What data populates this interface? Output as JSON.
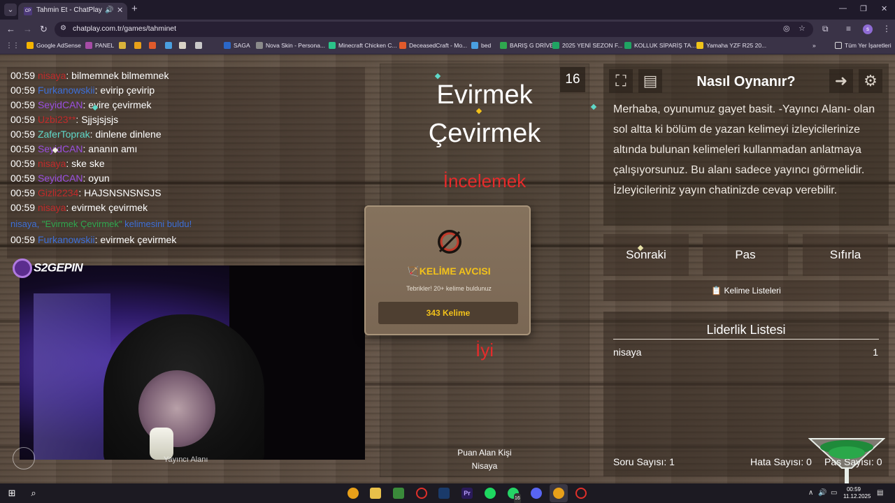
{
  "browser": {
    "tab_title": "Tahmin Et - ChatPlay",
    "tab_favicon": "CP",
    "url": "chatplay.com.tr/games/tahminet",
    "profile_initial": "s",
    "bookmarks": [
      {
        "label": "Google AdSense",
        "color": "#f4b400"
      },
      {
        "label": "PANEL",
        "color": "#a64ca6"
      },
      {
        "label": "",
        "color": "#d8b23a"
      },
      {
        "label": "",
        "color": "#e8a019"
      },
      {
        "label": "",
        "color": "#e05a2b"
      },
      {
        "label": "",
        "color": "#4a9fe0"
      },
      {
        "label": "",
        "color": "#d9d3c6"
      },
      {
        "label": "",
        "color": "#c9c9c9"
      },
      {
        "label": "SAGA",
        "color": "#2b67c8"
      },
      {
        "label": "Nova Skin - Persona...",
        "color": "#8a8a8a"
      },
      {
        "label": "Minecraft Chicken C...",
        "color": "#2bc48a"
      },
      {
        "label": "DeceasedCraft - Mo...",
        "color": "#e05a2b"
      },
      {
        "label": "bed",
        "color": "#4a9fe0"
      },
      {
        "label": "BARIŞ G DRİVE",
        "color": "#2fa84f"
      },
      {
        "label": "2025 YENİ SEZON F...",
        "color": "#1fa463"
      },
      {
        "label": "KOLLUK SİPARİŞ TA...",
        "color": "#1fa463"
      },
      {
        "label": "Yamaha YZF R25 20...",
        "color": "#f0c419"
      }
    ],
    "all_bookmarks": "Tüm Yer İşaretleri"
  },
  "chat": [
    {
      "time": "00:59",
      "user": "nisaya",
      "color": "#c02a2a",
      "msg": ": bilmemnek bilmemnek"
    },
    {
      "time": "00:59",
      "user": "Furkanowskii",
      "color": "#3d6fd8",
      "msg": ": evirip çevirip"
    },
    {
      "time": "00:59",
      "user": "SeyidCAN",
      "color": "#9a4fe0",
      "msg": ": evire çevirmek"
    },
    {
      "time": "00:59",
      "user": "Uzbi23**",
      "color": "#c02a2a",
      "msg": ": Sjjsjsjsjs"
    },
    {
      "time": "00:59",
      "user": "ZaferToprak",
      "color": "#5fd8c8",
      "msg": ": dinlene dinlene"
    },
    {
      "time": "00:59",
      "user": "SeyidCAN",
      "color": "#9a4fe0",
      "msg": ": ananın amı"
    },
    {
      "time": "00:59",
      "user": "nisaya",
      "color": "#c02a2a",
      "msg": ": ske ske"
    },
    {
      "time": "00:59",
      "user": "SeyidCAN",
      "color": "#9a4fe0",
      "msg": ": oyun"
    },
    {
      "time": "00:59",
      "user": "Gizli2234",
      "color": "#c02a2a",
      "msg": ": HAJSNSNSNSJS"
    },
    {
      "time": "00:59",
      "user": "nisaya",
      "color": "#c02a2a",
      "msg": ": evirmek çevirmek"
    }
  ],
  "system_msg": {
    "user": "nisaya,",
    "word": "\"Evirmek Çevirmek\"",
    "suffix": " kelimesini buldu!"
  },
  "last_chat": {
    "time": "00:59",
    "user": "Furkanowskii",
    "color": "#3d6fd8",
    "msg": ": evirmek çevirmek"
  },
  "stream": {
    "logo": "S2GEPIN",
    "label": "Yayıncı Alanı"
  },
  "game": {
    "word_count": "16",
    "word_line1": "Evirmek",
    "word_line2": "Çevirmek",
    "taboo1": "İncelemek",
    "taboo2": "İyi",
    "scorer_label": "Puan Alan Kişi",
    "scorer_name": "Nisaya"
  },
  "achievement": {
    "title": "KELİME AVCISI",
    "subtitle": "Tebrikler! 20+ kelime buldunuz",
    "button": "343 Kelime"
  },
  "info": {
    "title": "Nasıl Oynanır?",
    "text": "Merhaba, oyunumuz gayet basit. -Yayıncı Alanı- olan sol altta ki bölüm de yazan kelimeyi izleyicilerinize altında bulunan kelimeleri kullanmadan anlatmaya çalışıyorsunuz. Bu alanı sadece yayıncı görmelidir. İzleyicileriniz yayın chatinizde cevap verebilir."
  },
  "actions": {
    "next": "Sonraki",
    "pass": "Pas",
    "reset": "Sıfırla",
    "word_lists": "Kelime Listeleri"
  },
  "leaderboard": {
    "title": "Liderlik Listesi",
    "rows": [
      {
        "name": "nisaya",
        "score": "1"
      }
    ]
  },
  "stats": {
    "questions": "Soru Sayısı: 1",
    "errors": "Hata Sayısı: 0",
    "pass": "Pas Sayısı: 0"
  },
  "taskbar": {
    "time": "00:59",
    "date": "11.12.2025",
    "whatsapp_badge": "16"
  }
}
